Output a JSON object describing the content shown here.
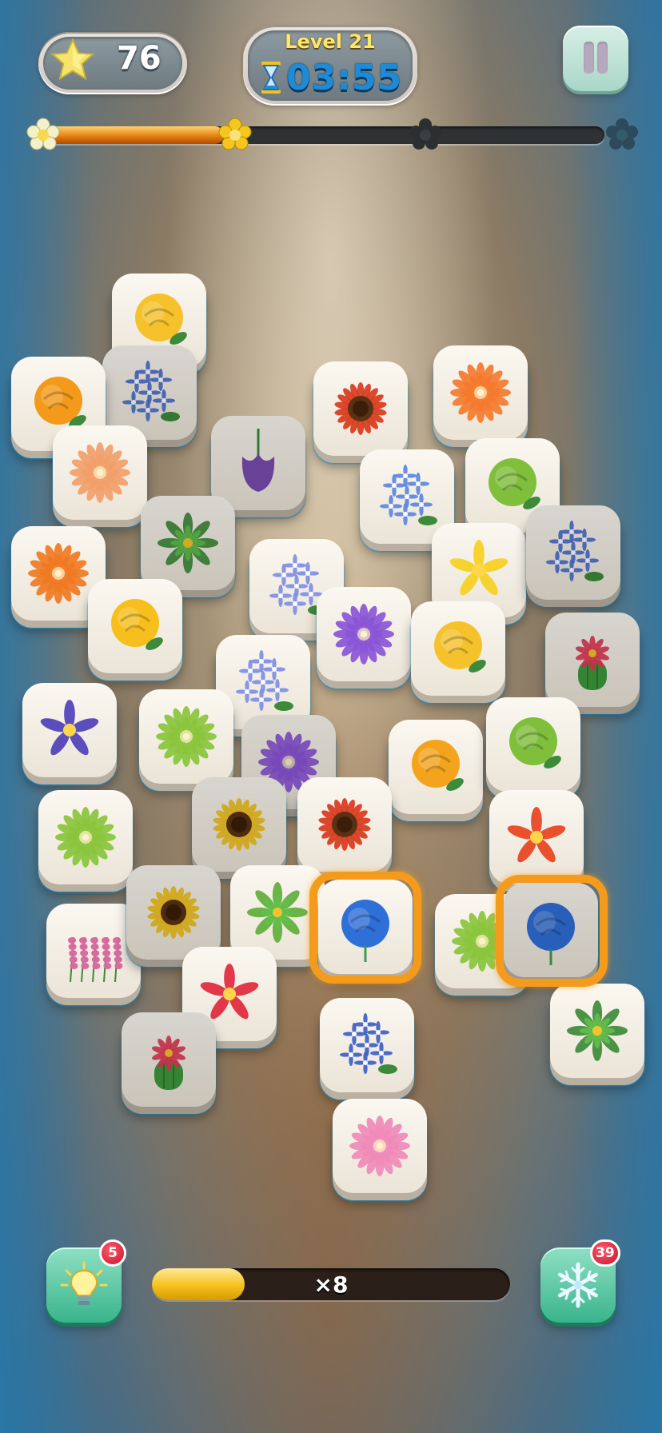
{
  "hud": {
    "stars": "76",
    "level_label": "Level 21",
    "timer": "03:55",
    "level_progress": 0.32
  },
  "boosters": {
    "hint_count": "5",
    "freeze_count": "39"
  },
  "combo": {
    "label": "×8",
    "fill": 0.26
  },
  "icons": {
    "star": "star-icon",
    "hourglass": "hourglass-icon",
    "pause": "pause-icon",
    "hint": "lightbulb-icon",
    "freeze": "snowflake-icon"
  },
  "colors": {
    "selection": "#f49b1c",
    "timer": "#1e8bd6",
    "level_text": "#ffe56a"
  },
  "tiles": [
    {
      "flower": "yellow-rose",
      "color": "#f6c22b"
    },
    {
      "flower": "blue-water-lily",
      "color": "#4a6fd0"
    },
    {
      "flower": "orange-peony",
      "color": "#f39a1a"
    },
    {
      "flower": "red-sunflower",
      "color": "#d83a1c"
    },
    {
      "flower": "orange-dahlia",
      "color": "#f47a2c"
    },
    {
      "flower": "purple-tulip",
      "color": "#7a4cb0"
    },
    {
      "flower": "peach-dahlia",
      "color": "#f2a06a"
    },
    {
      "flower": "blue-hydrangea",
      "color": "#5d86e0"
    },
    {
      "flower": "green-rose",
      "color": "#7fbf3c"
    },
    {
      "flower": "green-succulent",
      "color": "#3d8a3a"
    },
    {
      "flower": "orange-chrysanthemum",
      "color": "#f07a22"
    },
    {
      "flower": "blue-plumbago",
      "color": "#7f8ee6"
    },
    {
      "flower": "yellow-frangipani",
      "color": "#f5d020"
    },
    {
      "flower": "blue-water-lily",
      "color": "#4a6fd0"
    },
    {
      "flower": "yellow-carnation",
      "color": "#f7bf1c"
    },
    {
      "flower": "purple-aster",
      "color": "#8a55d6"
    },
    {
      "flower": "yellow-rose",
      "color": "#f6c22b"
    },
    {
      "flower": "cactus-flower",
      "color": "#e23a55"
    },
    {
      "flower": "blue-plumbago",
      "color": "#7f8ee6"
    },
    {
      "flower": "purple-violet",
      "color": "#4f3fb8"
    },
    {
      "flower": "green-chrysanthemum",
      "color": "#8ac43c"
    },
    {
      "flower": "purple-aster",
      "color": "#8a55d6"
    },
    {
      "flower": "orange-peony",
      "color": "#f3a41c"
    },
    {
      "flower": "green-rose",
      "color": "#7fbf3c"
    },
    {
      "flower": "green-chrysanthemum",
      "color": "#8ac43c"
    },
    {
      "flower": "sunflower",
      "color": "#f2c21c"
    },
    {
      "flower": "red-sunflower",
      "color": "#d83a1c"
    },
    {
      "flower": "red-lily",
      "color": "#e8421e"
    },
    {
      "flower": "pink-lavender",
      "color": "#d86aa0"
    },
    {
      "flower": "sunflower",
      "color": "#f2c21c"
    },
    {
      "flower": "green-succulent",
      "color": "#5fae3a"
    },
    {
      "flower": "blue-carnation",
      "color": "#2f6fd8"
    },
    {
      "flower": "green-chrysanthemum",
      "color": "#8ac43c"
    },
    {
      "flower": "blue-carnation",
      "color": "#2f6fd8"
    },
    {
      "flower": "red-frangipani",
      "color": "#e0283c"
    },
    {
      "flower": "blue-hydrangea",
      "color": "#3d5fc8"
    },
    {
      "flower": "green-succulent",
      "color": "#3d8a3a"
    },
    {
      "flower": "cactus-flower",
      "color": "#e23a55"
    },
    {
      "flower": "pink-dahlia",
      "color": "#ef8ab8"
    }
  ]
}
